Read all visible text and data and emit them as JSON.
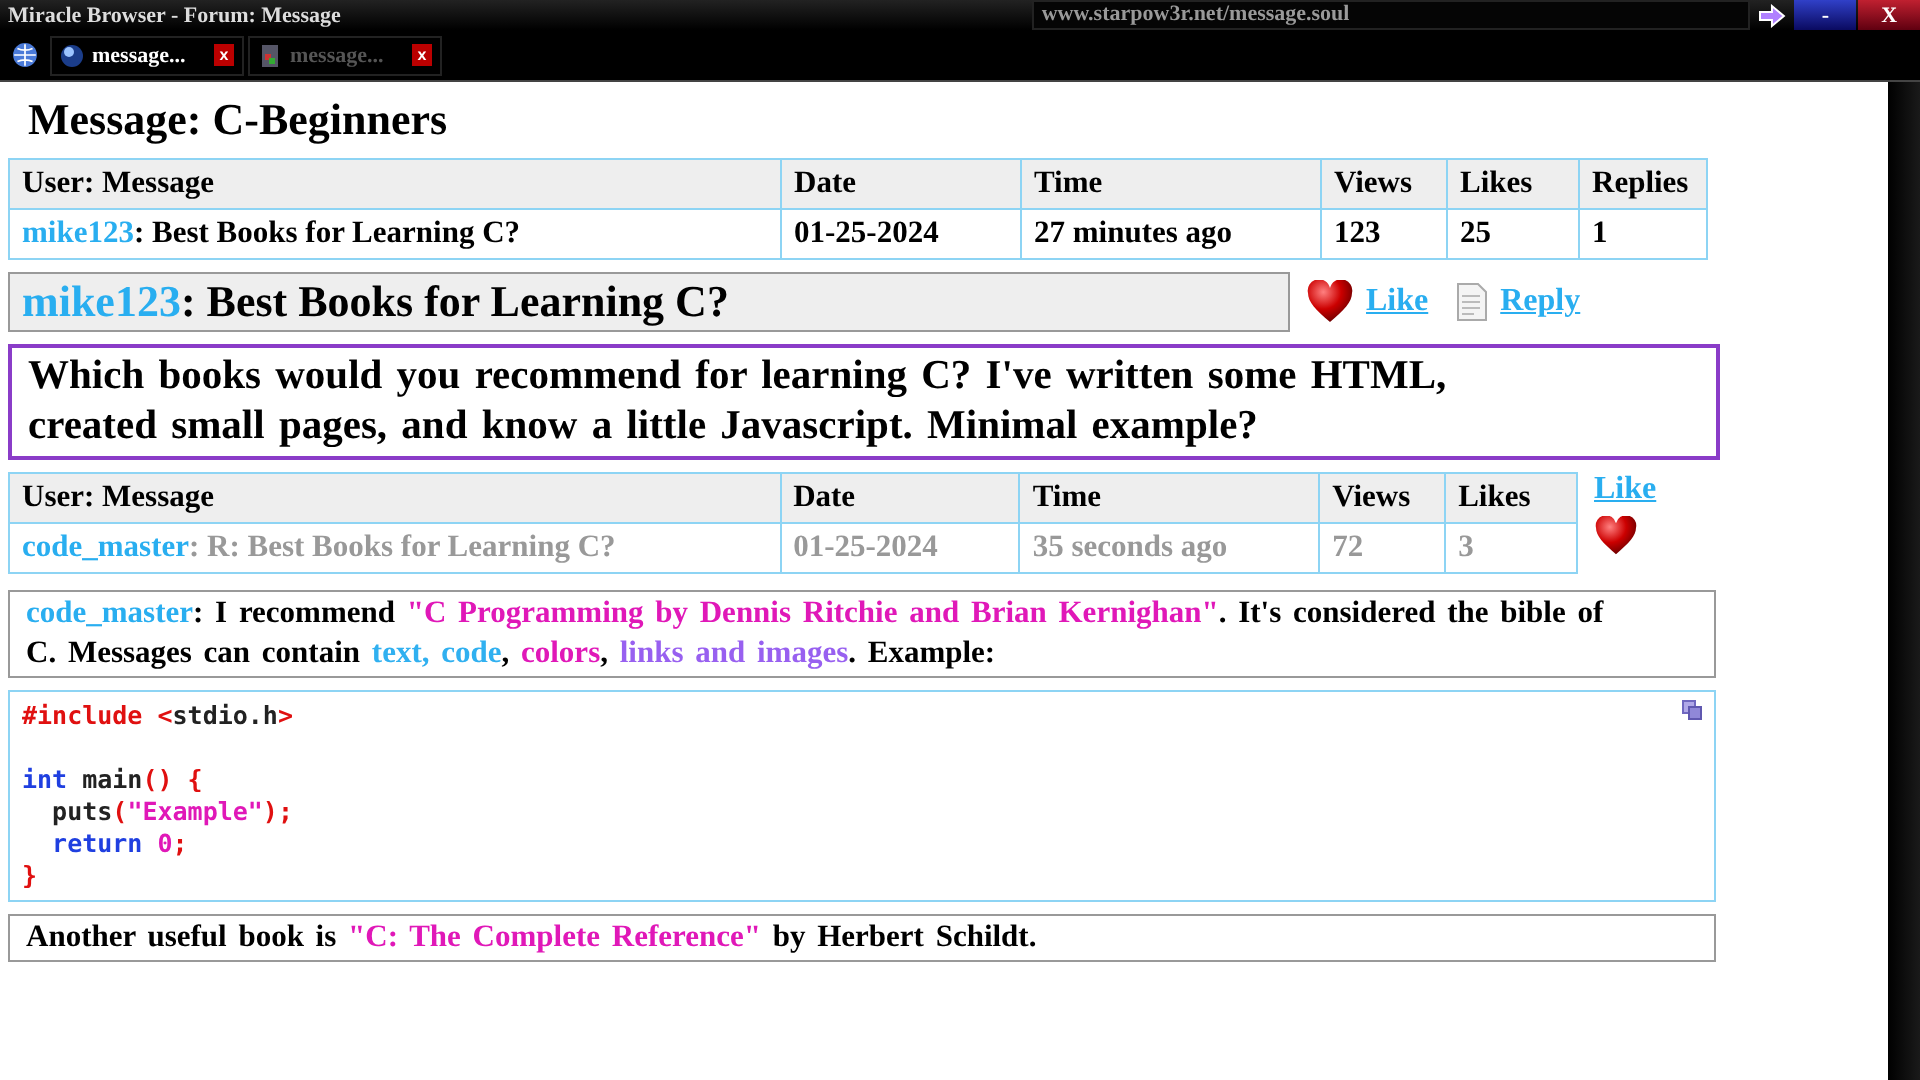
{
  "browser": {
    "title": "Miracle Browser - Forum: Message",
    "url": "www.starpow3r.net/message.soul",
    "minimize": "-",
    "close": "X"
  },
  "tabs": [
    {
      "label": "message...",
      "selected": true,
      "close": "x"
    },
    {
      "label": "message...",
      "selected": false,
      "close": "x"
    }
  ],
  "heading": "Message: C-Beginners",
  "topic_table": {
    "columns": [
      "User: Message",
      "Date",
      "Time",
      "Views",
      "Likes",
      "Replies"
    ],
    "rows": [
      {
        "cells": [
          {
            "user": "mike123",
            "subject": ": Best Books for Learning C?"
          },
          "01-25-2024",
          "27 minutes ago",
          "123",
          "25",
          "1"
        ],
        "dimmed": false
      }
    ]
  },
  "thread": {
    "user": "mike123",
    "subject": ": Best Books for Learning C?",
    "actions": [
      {
        "kind": "like",
        "label": "Like"
      },
      {
        "kind": "reply",
        "label": "Reply"
      }
    ]
  },
  "question": "Which books would you recommend for learning C? I've written some HTML, created small pages, and know a little Javascript. Minimal example?",
  "reply_table": {
    "columns": [
      "User: Message",
      "Date",
      "Time",
      "Views",
      "Likes"
    ],
    "like": "Like",
    "rows": [
      {
        "cells": [
          {
            "user": "code_master",
            "subject": ": R: Best Books for Learning C?"
          },
          "01-25-2024",
          "35 seconds ago",
          "72",
          "3"
        ],
        "dimmed": true
      }
    ]
  },
  "reply": [
    {
      "kind": "user",
      "text": "code_master"
    },
    {
      "kind": "plain",
      "text": ": I recommend "
    },
    {
      "kind": "quote",
      "text": "\"C Programming by Dennis Ritchie and Brian Kernighan\""
    },
    {
      "kind": "plain",
      "text": ". It's considered the bible of C. Messages can contain "
    },
    {
      "kind": "blue",
      "text": "text, code"
    },
    {
      "kind": "plain",
      "text": ", "
    },
    {
      "kind": "quote",
      "text": "colors"
    },
    {
      "kind": "plain",
      "text": ", "
    },
    {
      "kind": "purple",
      "text": "links and images"
    },
    {
      "kind": "plain",
      "text": ". Example:"
    }
  ],
  "code": [
    {
      "kind": "code",
      "tokens": [
        {
          "kind": "punct",
          "text": "#include <"
        },
        {
          "kind": "plain",
          "text": "stdio.h"
        },
        {
          "kind": "punct",
          "text": ">"
        }
      ]
    },
    {
      "kind": "blank"
    },
    {
      "kind": "code",
      "tokens": [
        {
          "kind": "keyword",
          "text": "int"
        },
        {
          "kind": "plain",
          "text": " main"
        },
        {
          "kind": "punct",
          "text": "() {"
        }
      ]
    },
    {
      "kind": "code",
      "tokens": [
        {
          "kind": "plain",
          "text": "  puts"
        },
        {
          "kind": "punct",
          "text": "("
        },
        {
          "kind": "string",
          "text": "\"Example\""
        },
        {
          "kind": "punct",
          "text": ");"
        }
      ]
    },
    {
      "kind": "code",
      "tokens": [
        {
          "kind": "keyword",
          "text": "  return"
        },
        {
          "kind": "string",
          "text": " 0"
        },
        {
          "kind": "punct",
          "text": ";"
        }
      ]
    },
    {
      "kind": "code",
      "tokens": [
        {
          "kind": "punct",
          "text": "}"
        }
      ]
    }
  ],
  "footer": [
    {
      "kind": "plain",
      "text": "Another useful book is "
    },
    {
      "kind": "quote",
      "text": "\"C: The Complete Reference\""
    },
    {
      "kind": "plain",
      "text": " by Herbert Schildt."
    }
  ]
}
